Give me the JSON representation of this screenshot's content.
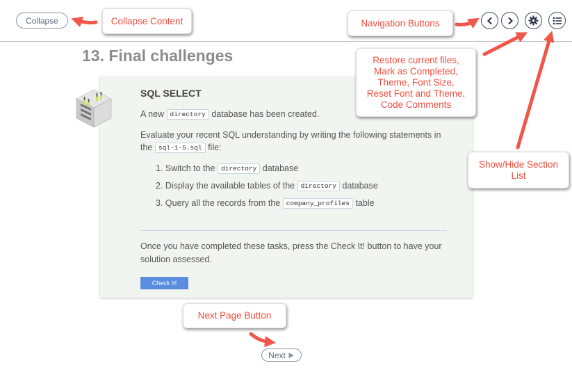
{
  "toolbar": {
    "collapse_label": "Collapse",
    "next_label": "Next"
  },
  "page": {
    "title": "13. Final challenges"
  },
  "task": {
    "heading": "SQL SELECT",
    "intro_before": "A new",
    "intro_code": "directory",
    "intro_after": "database has been created.",
    "eval_text": "Evaluate your recent SQL understanding by writing the following statements in the",
    "eval_code": "sql-1-5.sql",
    "eval_after": "file:",
    "steps": [
      {
        "before": "1. Switch to the",
        "code": "directory",
        "after": "database"
      },
      {
        "before": "2. Display the available tables of the",
        "code": "directory",
        "after": "database"
      },
      {
        "before": "3. Query all the records from the",
        "code": "company_profiles",
        "after": "table"
      }
    ],
    "completion_text": "Once you have completed these tasks, press the Check It! button to have your solution assessed.",
    "check_label": "Check It!"
  },
  "callouts": {
    "collapse": "Collapse Content",
    "navigation": "Navigation Buttons",
    "settings_lines": [
      "Restore current files,",
      "Mark as Completed,",
      "Theme, Font Size,",
      "Reset Font and Theme,",
      "Code Comments"
    ],
    "section_list_lines": [
      "Show/Hide Section",
      "List"
    ],
    "next_page": "Next Page Button"
  },
  "icons": {
    "prev": "chevron-left-icon",
    "next_nav": "chevron-right-icon",
    "settings": "gear-icon",
    "sections": "list-icon",
    "lab": "server-lab-icon",
    "next_play": "play-icon"
  },
  "colors": {
    "callout_text": "#f04e3e",
    "arrow": "#f0574a",
    "check_button": "#5a8de0",
    "card_bg": "#f1f5f0"
  }
}
